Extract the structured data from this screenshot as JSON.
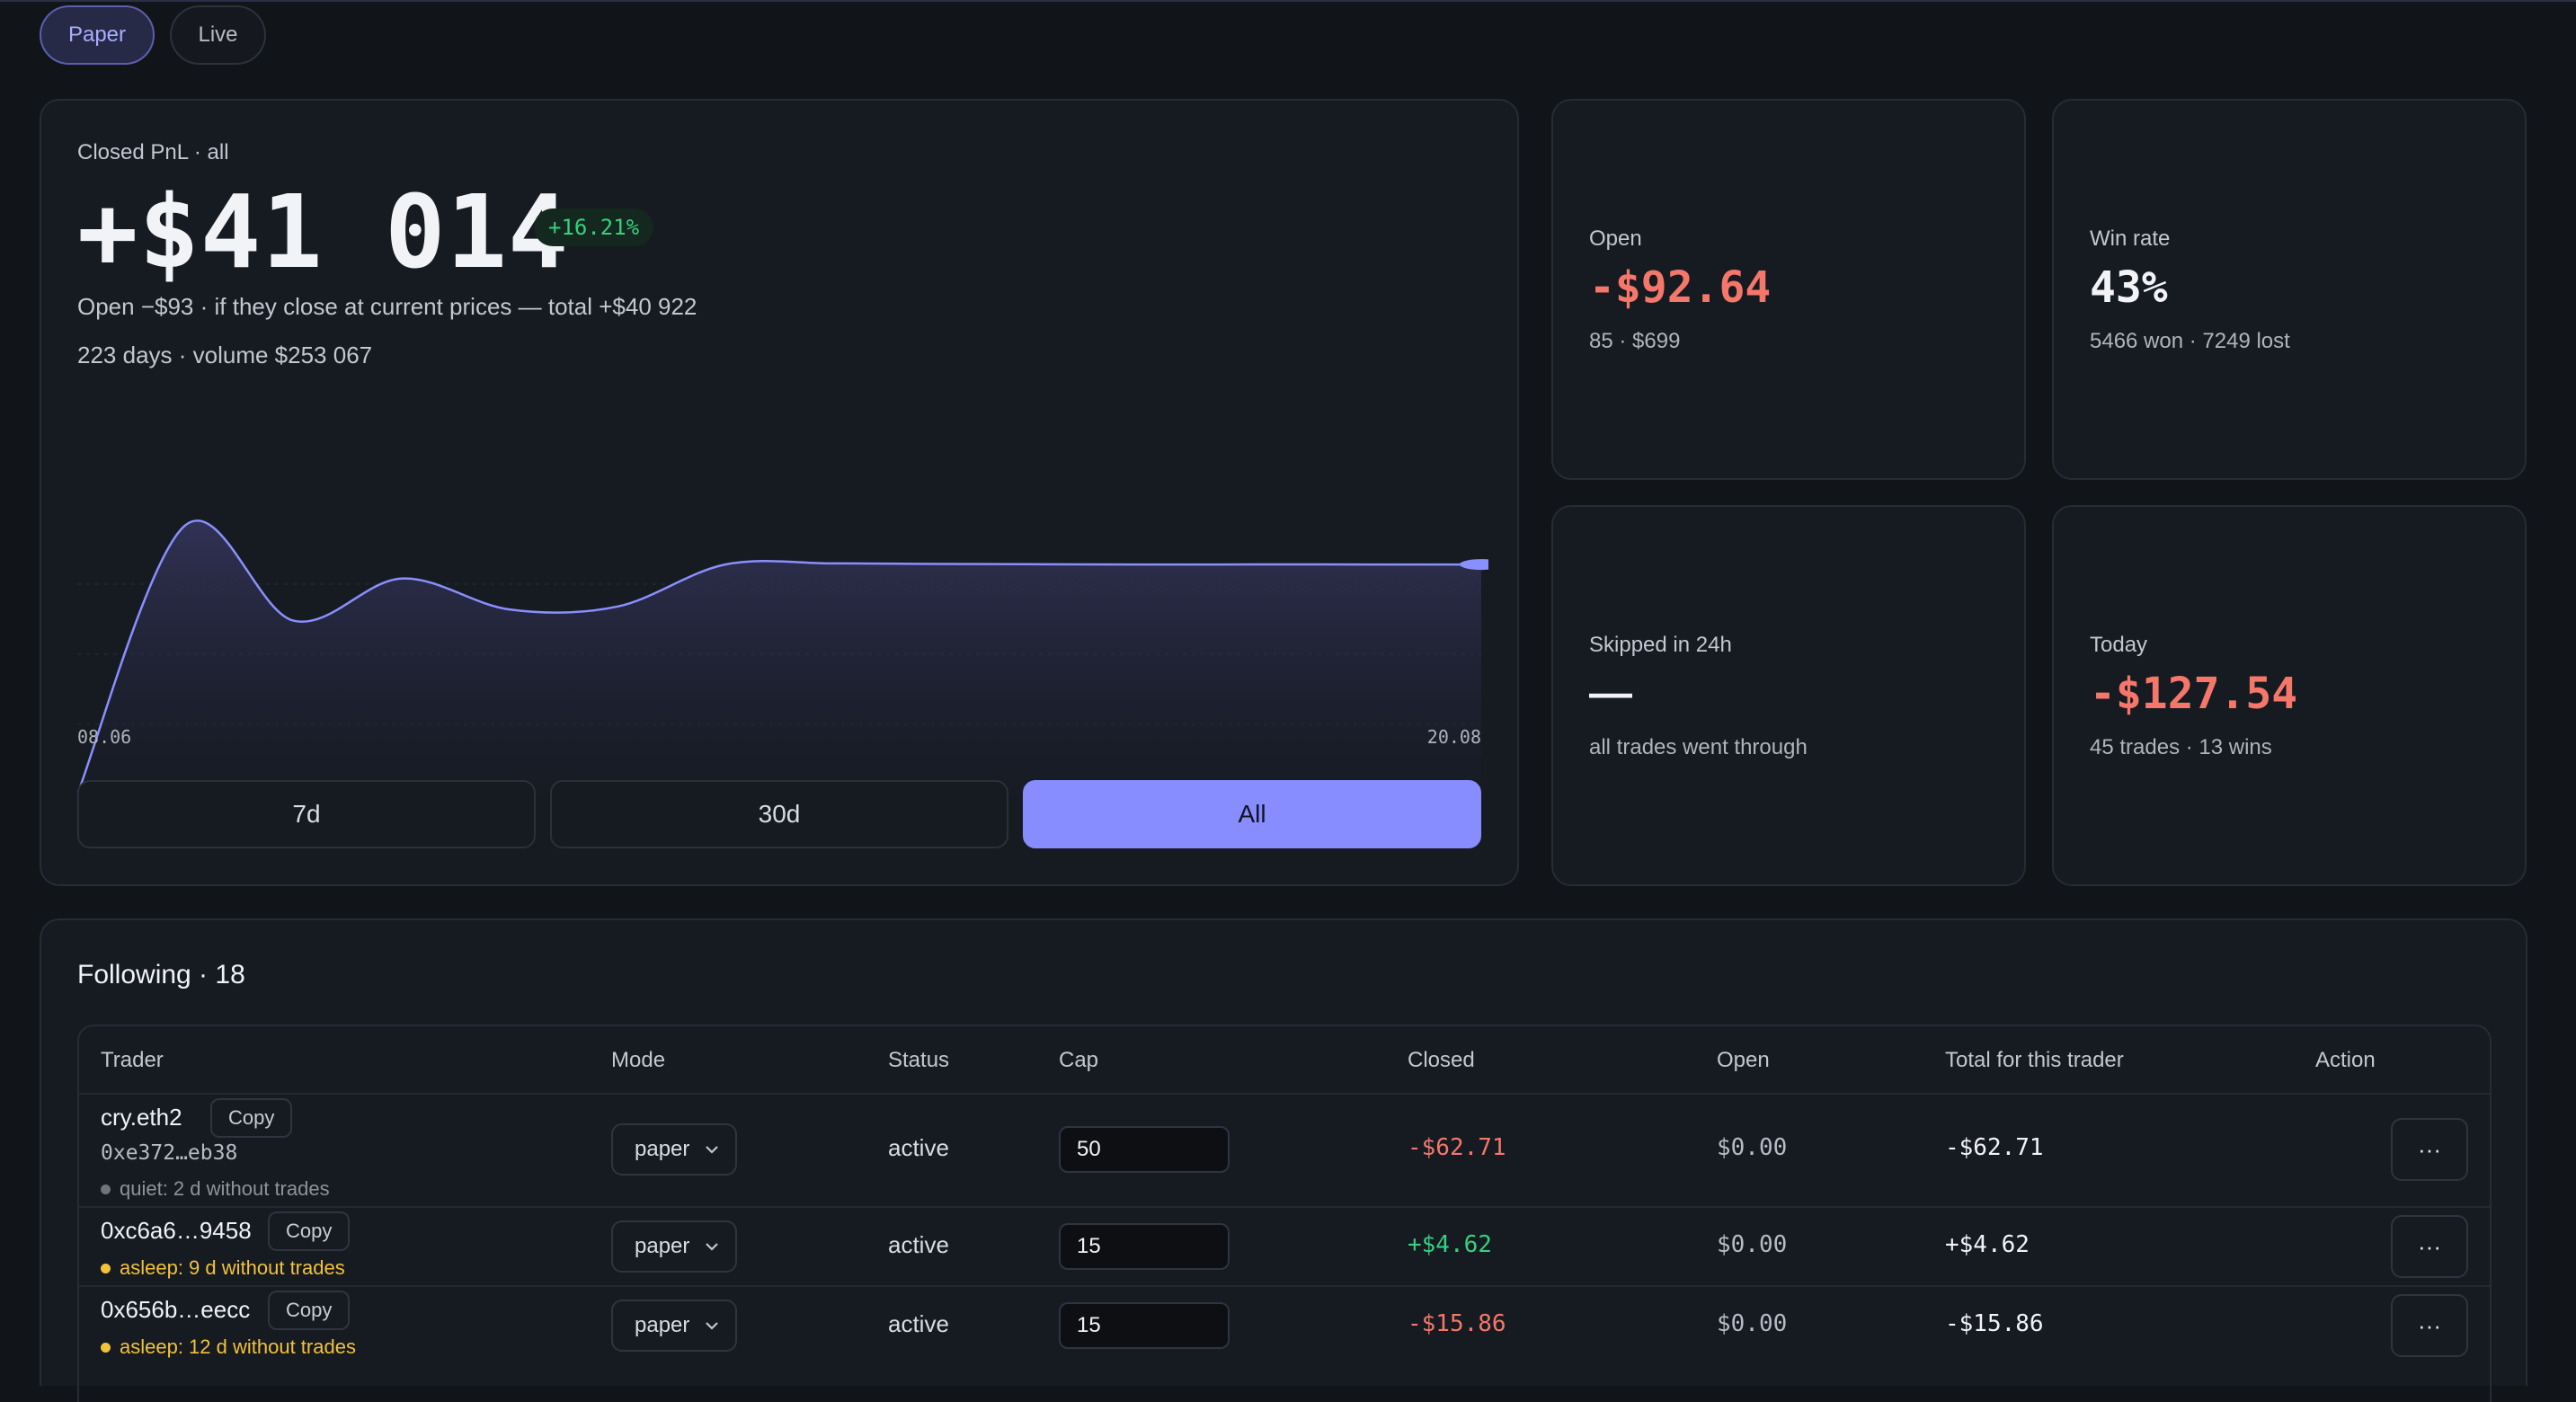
{
  "tabs": {
    "paper": "Paper",
    "live": "Live"
  },
  "pnl": {
    "label": "Closed PnL · all",
    "value": "+$41 014",
    "badge": "+16.21%",
    "line1": "Open −$93 · if they close at current prices — total +$40 922",
    "line2": "223 days · volume $253 067",
    "ranges": [
      "7d",
      "30d",
      "All"
    ],
    "active_range": "All"
  },
  "chart_data": {
    "type": "area",
    "x_tick_labels": [
      "08.06",
      "20.08"
    ],
    "x": [
      "08.06",
      "",
      "",
      "",
      "",
      "",
      "",
      "",
      "",
      "",
      "",
      "",
      "",
      "20.08"
    ],
    "values": [
      0,
      48000,
      31000,
      38500,
      33000,
      33500,
      41000,
      41200,
      41100,
      41050,
      41000,
      41020,
      41010,
      41014
    ],
    "ylim": [
      0,
      50000
    ],
    "grid": true,
    "colors": {
      "line": "#8a8fff",
      "fill": "#3a3a66"
    }
  },
  "stats": {
    "open": {
      "label": "Open",
      "value": "-$92.64",
      "sub": "85 · $699"
    },
    "winrate": {
      "label": "Win rate",
      "value": "43%",
      "sub": "5466 won · 7249 lost"
    },
    "skipped": {
      "label": "Skipped in 24h",
      "value": "—",
      "sub": "all trades went through"
    },
    "today": {
      "label": "Today",
      "value": "-$127.54",
      "sub": "45 trades · 13 wins"
    }
  },
  "following": {
    "title": "Following · 18",
    "columns": [
      "Trader",
      "Mode",
      "Status",
      "Cap",
      "Closed",
      "Open",
      "Total for this trader",
      "Action"
    ],
    "copy_label": "Copy",
    "rows": [
      {
        "name": "cry.eth2",
        "addr": "0xe372…eb38",
        "note": "quiet: 2 d without trades",
        "mode": "paper",
        "status": "active",
        "cap": "50",
        "closed": "-$62.71",
        "open": "$0.00",
        "total": "-$62.71",
        "action": "···"
      },
      {
        "name": "0xc6a6…9458",
        "addr": "",
        "note": "asleep: 9 d without trades",
        "mode": "paper",
        "status": "active",
        "cap": "15",
        "closed": "+$4.62",
        "open": "$0.00",
        "total": "+$4.62",
        "action": "···"
      },
      {
        "name": "0x656b…eecc",
        "addr": "",
        "note": "asleep: 12 d without trades",
        "mode": "paper",
        "status": "active",
        "cap": "15",
        "closed": "-$15.86",
        "open": "$0.00",
        "total": "-$15.86",
        "action": "···"
      }
    ]
  }
}
